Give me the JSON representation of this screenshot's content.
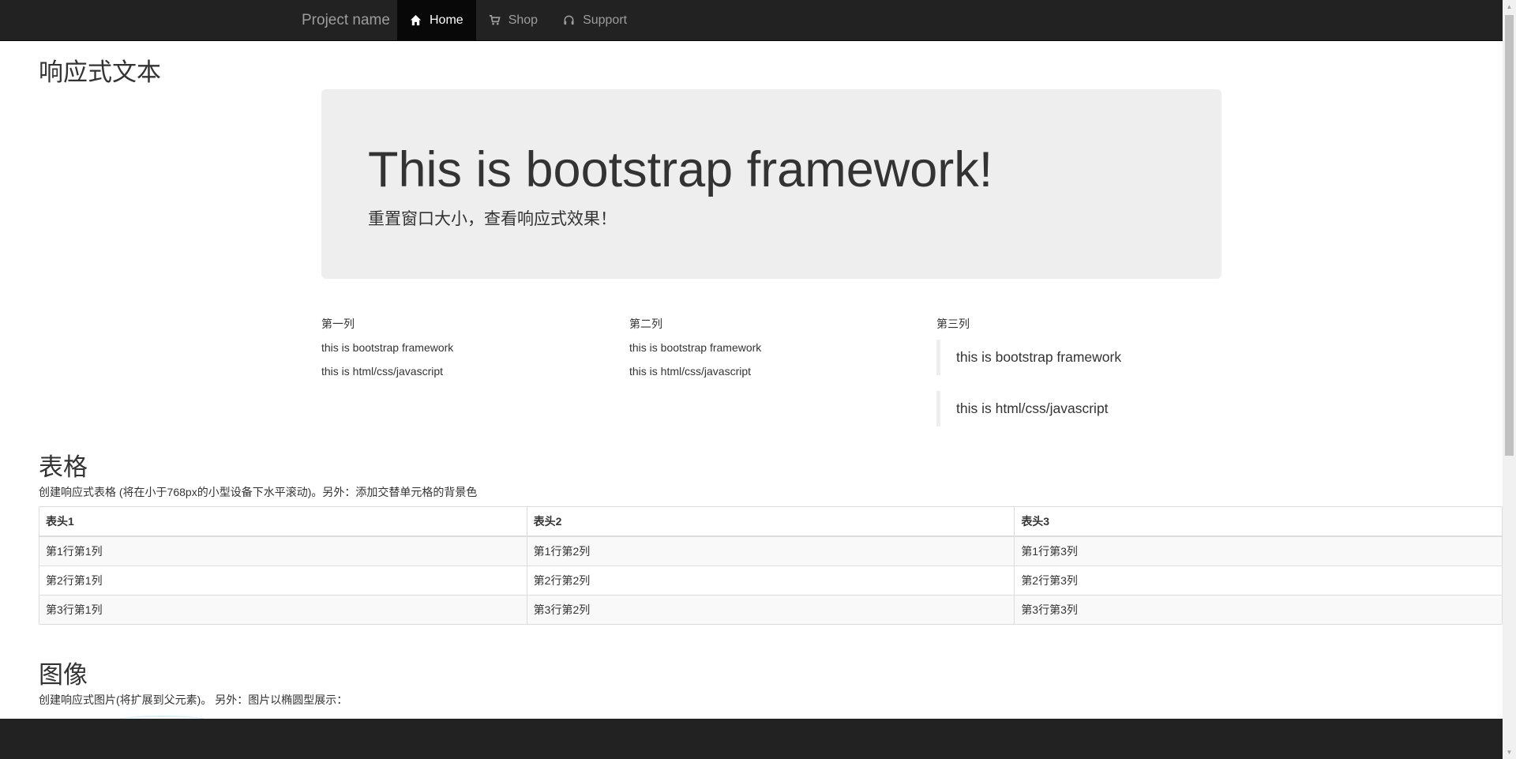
{
  "navbar": {
    "brand": "Project name",
    "items": [
      {
        "label": "Home",
        "icon": "home-icon",
        "active": true
      },
      {
        "label": "Shop",
        "icon": "shopping-cart-icon",
        "active": false
      },
      {
        "label": "Support",
        "icon": "headphones-icon",
        "active": false
      }
    ]
  },
  "page": {
    "responsive_heading": "响应式文本"
  },
  "jumbotron": {
    "title": "This is bootstrap framework!",
    "subtitle": "重置窗口大小，查看响应式效果！"
  },
  "columns": [
    {
      "title": "第一列",
      "lines": [
        "this is bootstrap framework",
        "this is html/css/javascript"
      ]
    },
    {
      "title": "第二列",
      "lines": [
        "this is bootstrap framework",
        "this is html/css/javascript"
      ]
    },
    {
      "title": "第三列",
      "quotes": [
        "this is bootstrap framework",
        "this is html/css/javascript"
      ]
    }
  ],
  "table_section": {
    "heading": "表格",
    "description": "创建响应式表格 (将在小于768px的小型设备下水平滚动)。另外：添加交替单元格的背景色",
    "headers": [
      "表头1",
      "表头2",
      "表头3"
    ],
    "rows": [
      [
        "第1行第1列",
        "第1行第2列",
        "第1行第3列"
      ],
      [
        "第2行第1列",
        "第2行第2列",
        "第2行第3列"
      ],
      [
        "第3行第1列",
        "第3行第2列",
        "第3行第3列"
      ]
    ]
  },
  "image_section": {
    "heading": "图像",
    "description": "创建响应式图片(将扩展到父元素)。 另外：图片以椭圆型展示："
  },
  "colors": {
    "navbar_bg": "#222222",
    "navbar_active_bg": "#080808",
    "jumbotron_bg": "#eeeeee",
    "striped_row_bg": "#f9f9f9"
  }
}
